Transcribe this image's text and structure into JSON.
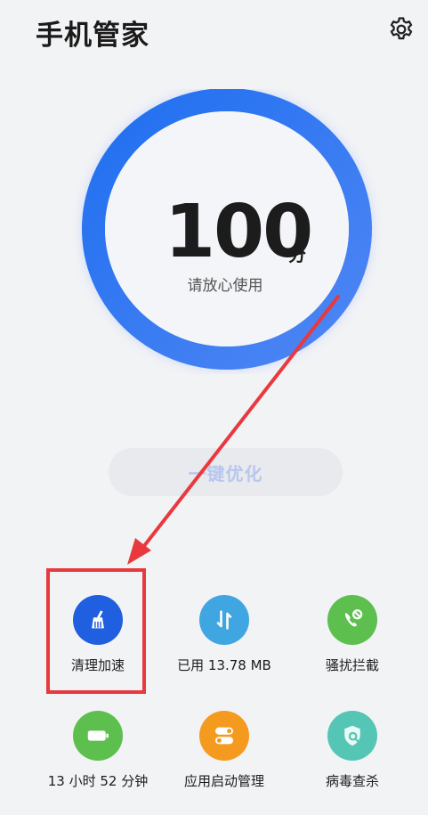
{
  "header": {
    "title": "手机管家"
  },
  "score": {
    "value": "100",
    "unit": "分",
    "status": "请放心使用",
    "level_percent": 100
  },
  "optimize": {
    "label": "一键优化"
  },
  "tools": [
    {
      "label": "清理加速",
      "icon": "broom-icon",
      "color": "#1f5fe0"
    },
    {
      "label": "已用 13.78 MB",
      "icon": "data-transfer-icon",
      "color": "#3fa6e2"
    },
    {
      "label": "骚扰拦截",
      "icon": "phone-block-icon",
      "color": "#5cbf4e"
    },
    {
      "label": "13 小时 52 分钟",
      "icon": "battery-icon",
      "color": "#5cbf4e"
    },
    {
      "label": "应用启动管理",
      "icon": "toggle-icon",
      "color": "#f49b1f"
    },
    {
      "label": "病毒查杀",
      "icon": "shield-search-icon",
      "color": "#55c6b5"
    }
  ],
  "colors": {
    "ring_start": "#1f6ff0",
    "ring_end": "#5a8df5",
    "annotation": "#e8393e"
  }
}
